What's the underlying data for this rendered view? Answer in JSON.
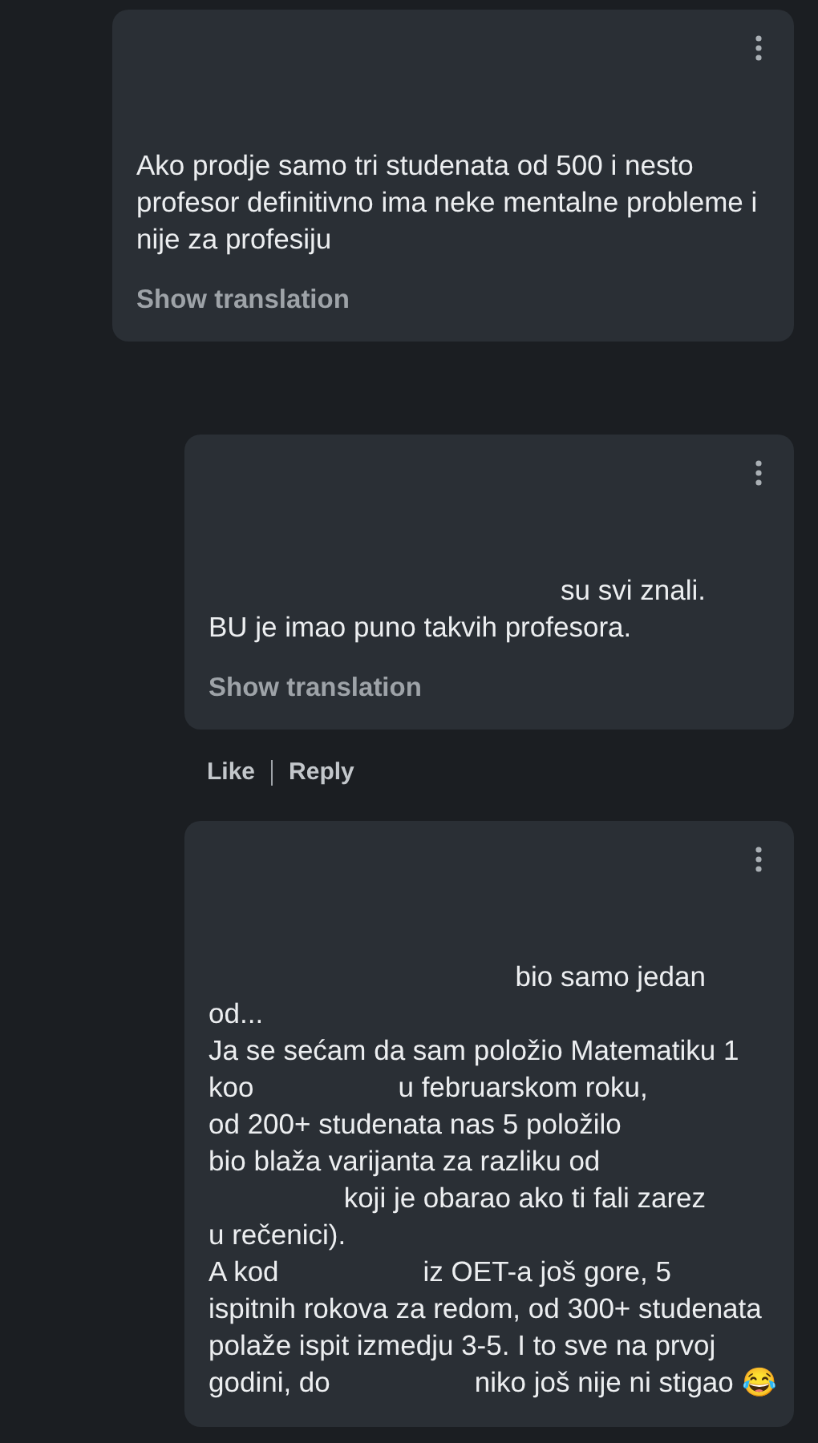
{
  "comments": [
    {
      "indent": false,
      "lines": [
        {
          "kind": "plain",
          "segments": [
            "Ako prodje samo tri studenata od 500 i nesto"
          ]
        },
        {
          "kind": "plain",
          "segments": [
            "profesor definitivno ima neke mentalne probleme i"
          ]
        },
        {
          "kind": "plain",
          "segments": [
            "nije za profesiju"
          ]
        }
      ],
      "translate": "Show translation"
    },
    {
      "indent": true,
      "lines": [
        {
          "kind": "after-gap",
          "segments": [
            "su svi znali."
          ]
        },
        {
          "kind": "plain",
          "segments": [
            "BU je imao puno takvih profesora."
          ]
        }
      ],
      "translate": "Show translation",
      "actions": [
        "Like",
        "Reply"
      ]
    },
    {
      "indent": true,
      "lines": [
        {
          "kind": "after-gap",
          "segments": [
            "bio samo jedan"
          ]
        },
        {
          "kind": "plain",
          "segments": [
            "od..."
          ]
        },
        {
          "kind": "plain",
          "segments": [
            "Ja se sećam da sam položio Matematiku 1"
          ]
        },
        {
          "kind": "plain",
          "segments": [
            "koo",
            "u februarskom roku,"
          ]
        },
        {
          "kind": "plain",
          "segments": [
            "od 200+ studenata nas 5 položilo"
          ]
        },
        {
          "kind": "plain",
          "segments": [
            "bio blaža varijanta za razliku od"
          ]
        },
        {
          "kind": "after-gap",
          "segments": [
            "koji je obarao ako ti fali zarez"
          ]
        },
        {
          "kind": "plain",
          "segments": [
            "u rečenici)."
          ]
        },
        {
          "kind": "plain",
          "segments": [
            "A kod",
            "iz OET-a još gore, 5"
          ]
        },
        {
          "kind": "plain",
          "segments": [
            "ispitnih rokova za redom, od 300+ studenata"
          ]
        },
        {
          "kind": "plain",
          "segments": [
            "polaže ispit izmedju 3-5. I to sve na prvoj"
          ]
        },
        {
          "kind": "plain",
          "segments": [
            "godini, do",
            "niko još nije ni stigao 😂"
          ]
        }
      ]
    }
  ]
}
